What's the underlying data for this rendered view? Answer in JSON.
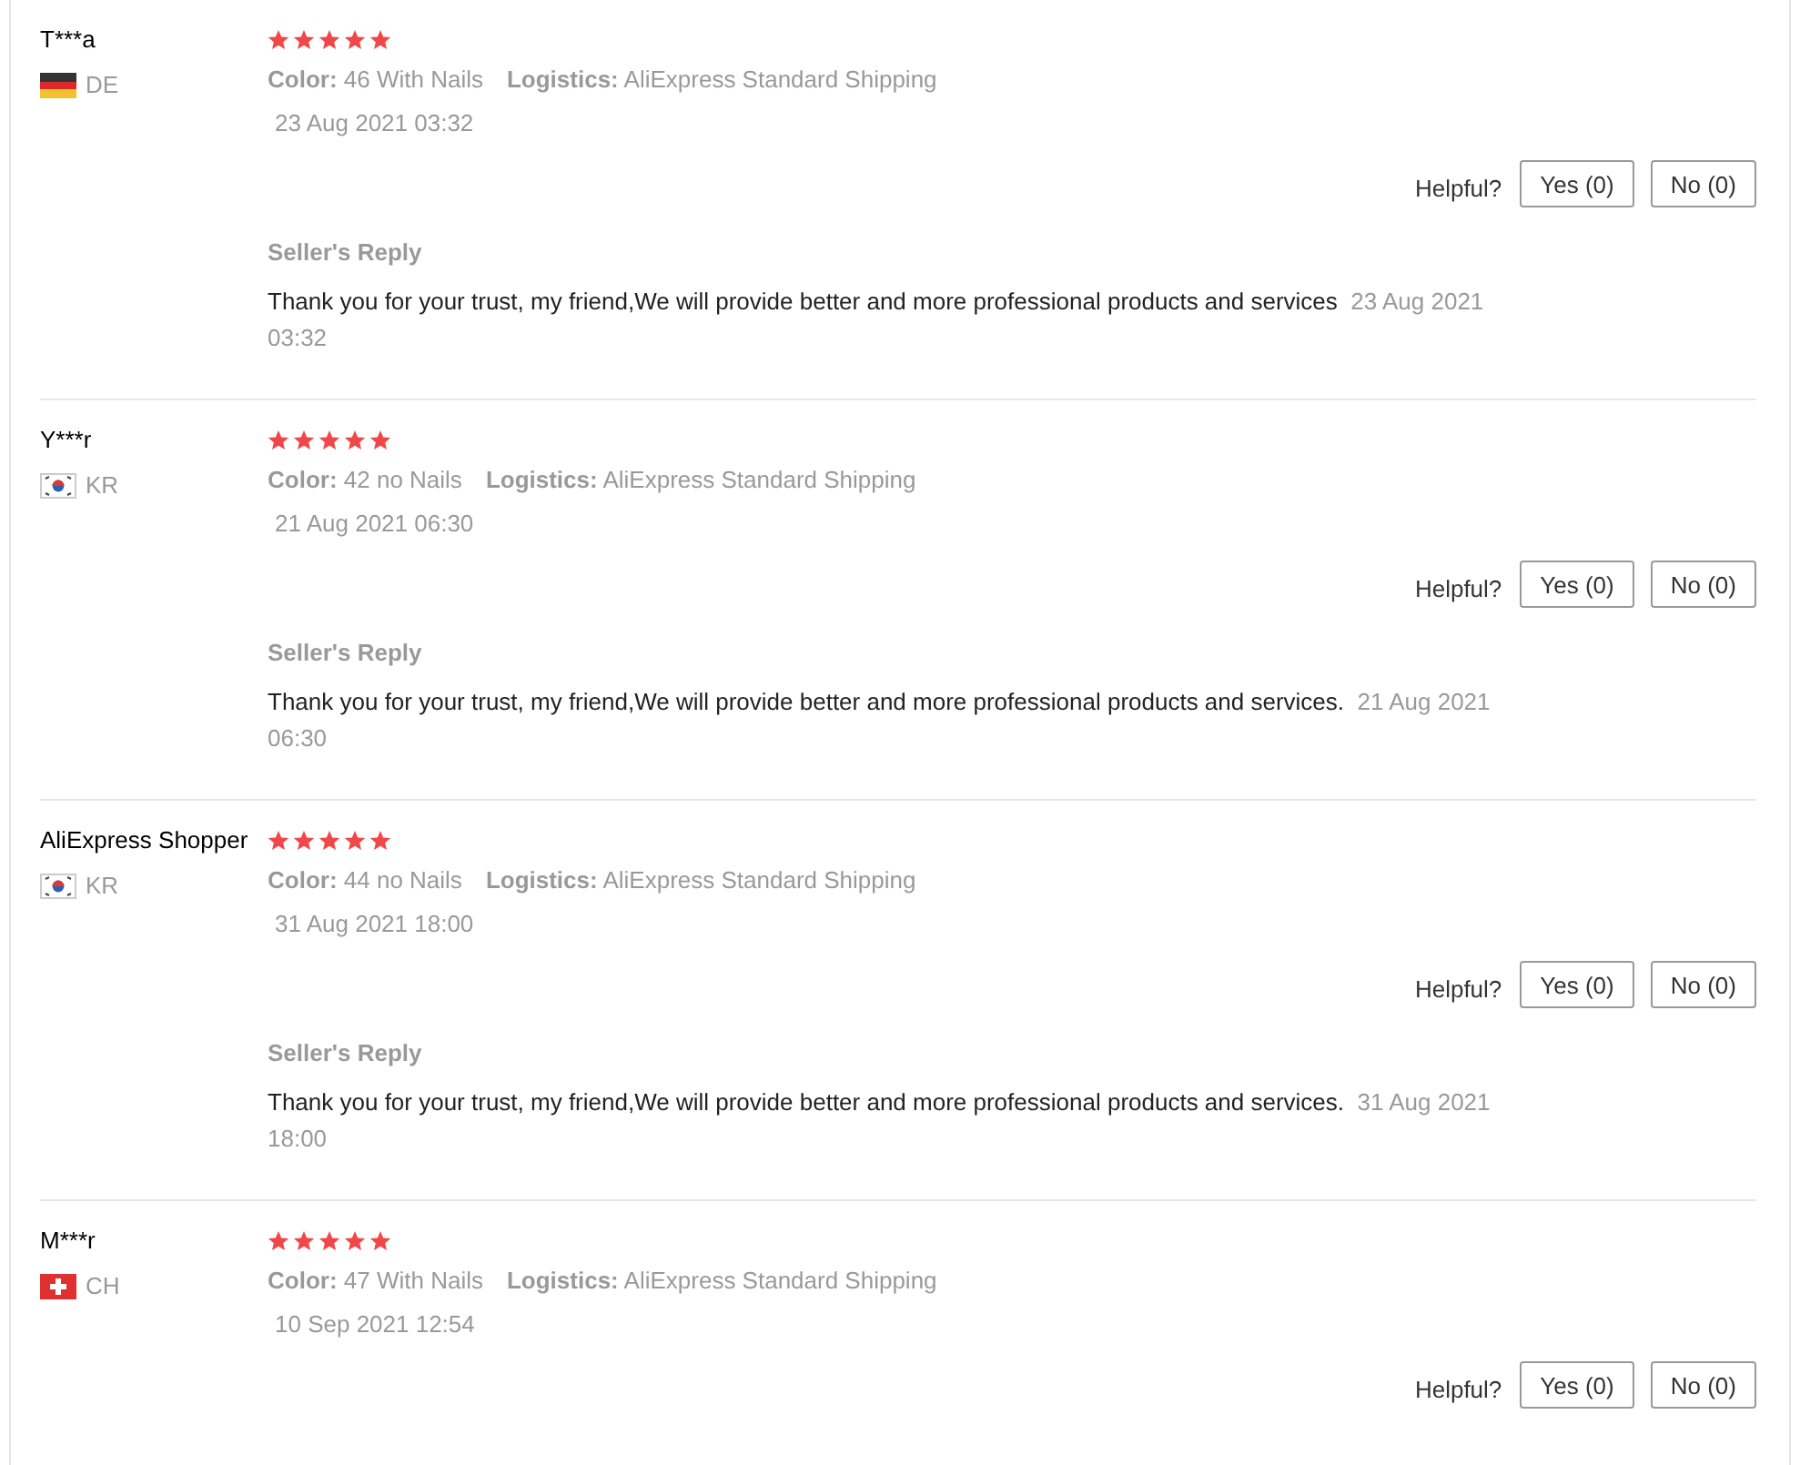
{
  "reviews": [
    {
      "name": "T***a",
      "kind": "de",
      "country": "DE",
      "stars": 5,
      "color_label": "Color:",
      "color_value": "46 With Nails",
      "logistics_label": "Logistics:",
      "logistics_value": "AliExpress Standard Shipping",
      "date": "23 Aug 2021 03:32",
      "helpful": "Helpful?",
      "yes": "Yes (0)",
      "no": "No (0)",
      "reply_title": "Seller's Reply",
      "reply_text": "Thank you for your trust, my friend,We will provide better and more professional products and services",
      "reply_date": "23 Aug 2021 03:32"
    },
    {
      "name": "Y***r",
      "kind": "kr",
      "country": "KR",
      "stars": 5,
      "color_label": "Color:",
      "color_value": "42 no Nails",
      "logistics_label": "Logistics:",
      "logistics_value": "AliExpress Standard Shipping",
      "date": "21 Aug 2021 06:30",
      "helpful": "Helpful?",
      "yes": "Yes (0)",
      "no": "No (0)",
      "reply_title": "Seller's Reply",
      "reply_text": "Thank you for your trust, my friend,We will provide better and more professional products and services.",
      "reply_date": "21 Aug 2021 06:30"
    },
    {
      "name": "AliExpress Shopper",
      "kind": "kr",
      "country": "KR",
      "stars": 5,
      "color_label": "Color:",
      "color_value": "44 no Nails",
      "logistics_label": "Logistics:",
      "logistics_value": "AliExpress Standard Shipping",
      "date": "31 Aug 2021 18:00",
      "helpful": "Helpful?",
      "yes": "Yes (0)",
      "no": "No (0)",
      "reply_title": "Seller's Reply",
      "reply_text": "Thank you for your trust, my friend,We will provide better and more professional products and services.",
      "reply_date": "31 Aug 2021 18:00"
    },
    {
      "name": "M***r",
      "kind": "ch",
      "country": "CH",
      "stars": 5,
      "color_label": "Color:",
      "color_value": "47 With Nails",
      "logistics_label": "Logistics:",
      "logistics_value": "AliExpress Standard Shipping",
      "date": "10 Sep 2021 12:54",
      "helpful": "Helpful?",
      "yes": "Yes (0)",
      "no": "No (0)"
    }
  ]
}
